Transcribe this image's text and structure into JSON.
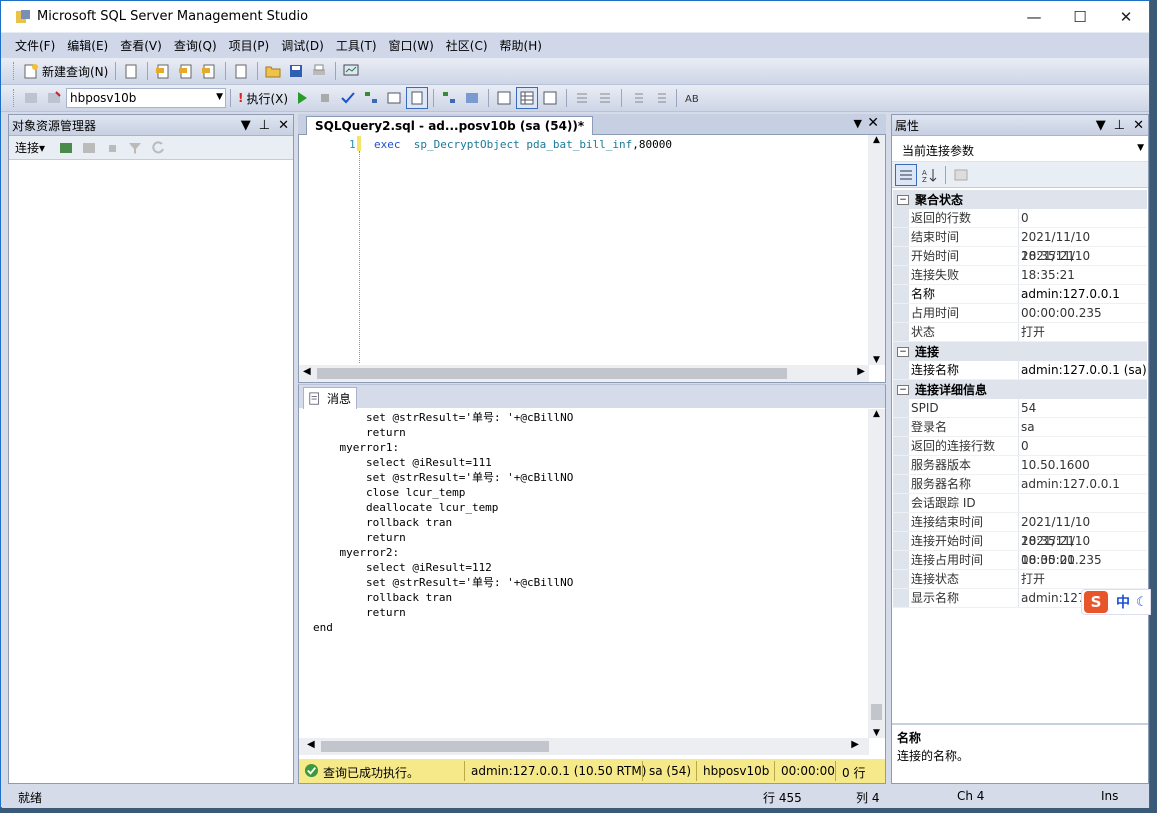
{
  "window": {
    "title": "Microsoft SQL Server Management Studio"
  },
  "menu": [
    "文件(F)",
    "编辑(E)",
    "查看(V)",
    "查询(Q)",
    "项目(P)",
    "调试(D)",
    "工具(T)",
    "窗口(W)",
    "社区(C)",
    "帮助(H)"
  ],
  "toolbar1": {
    "new_query": "新建查询(N)"
  },
  "toolbar2": {
    "database": "hbposv10b",
    "execute": "执行(X)"
  },
  "object_explorer": {
    "title": "对象资源管理器",
    "connect": "连接▾"
  },
  "editor": {
    "tab_title": "SQLQuery2.sql - ad...posv10b (sa (54))*",
    "line_number": "1",
    "code_keyword": "exec",
    "code_object": "sp_DecryptObject pda_bat_bill_inf",
    "code_rest": ",80000"
  },
  "messages": {
    "tab": "消息",
    "lines": [
      "        set @strResult='单号: '+@cBillNO",
      "        return",
      "    myerror1:",
      "        select @iResult=111",
      "        set @strResult='单号: '+@cBillNO",
      "        close lcur_temp",
      "        deallocate lcur_temp",
      "        rollback tran",
      "        return",
      "    myerror2:",
      "        select @iResult=112",
      "        set @strResult='单号: '+@cBillNO",
      "        rollback tran",
      "        return",
      "end"
    ]
  },
  "query_status": {
    "message": "查询已成功执行。",
    "server": "admin:127.0.0.1 (10.50 RTM)",
    "user": "sa (54)",
    "db": "hbposv10b",
    "time": "00:00:00",
    "rows": "0 行"
  },
  "properties": {
    "title": "属性",
    "selector": "当前连接参数",
    "categories": [
      {
        "name": "聚合状态",
        "rows": [
          [
            "返回的行数",
            "0"
          ],
          [
            "结束时间",
            "2021/11/10 18:35:21"
          ],
          [
            "开始时间",
            "2021/11/10 18:35:21"
          ],
          [
            "连接失败",
            ""
          ],
          [
            "名称",
            "admin:127.0.0.1"
          ],
          [
            "占用时间",
            "00:00:00.235"
          ],
          [
            "状态",
            "打开"
          ]
        ]
      },
      {
        "name": "连接",
        "rows": [
          [
            "连接名称",
            "admin:127.0.0.1 (sa)"
          ]
        ]
      },
      {
        "name": "连接详细信息",
        "rows": [
          [
            "SPID",
            "54"
          ],
          [
            "登录名",
            "sa"
          ],
          [
            "返回的连接行数",
            "0"
          ],
          [
            "服务器版本",
            "10.50.1600"
          ],
          [
            "服务器名称",
            "admin:127.0.0.1"
          ],
          [
            "会话跟踪 ID",
            ""
          ],
          [
            "连接结束时间",
            "2021/11/10 18:35:21"
          ],
          [
            "连接开始时间",
            "2021/11/10 18:35:21"
          ],
          [
            "连接占用时间",
            "00:00:00.235"
          ],
          [
            "连接状态",
            "打开"
          ],
          [
            "显示名称",
            "admin:127."
          ]
        ]
      }
    ],
    "desc_title": "名称",
    "desc_text": "连接的名称。"
  },
  "ime": {
    "lang": "中"
  },
  "status": {
    "ready": "就绪",
    "line": "行 455",
    "col": "列 4",
    "ch": "Ch 4",
    "ins": "Ins"
  }
}
